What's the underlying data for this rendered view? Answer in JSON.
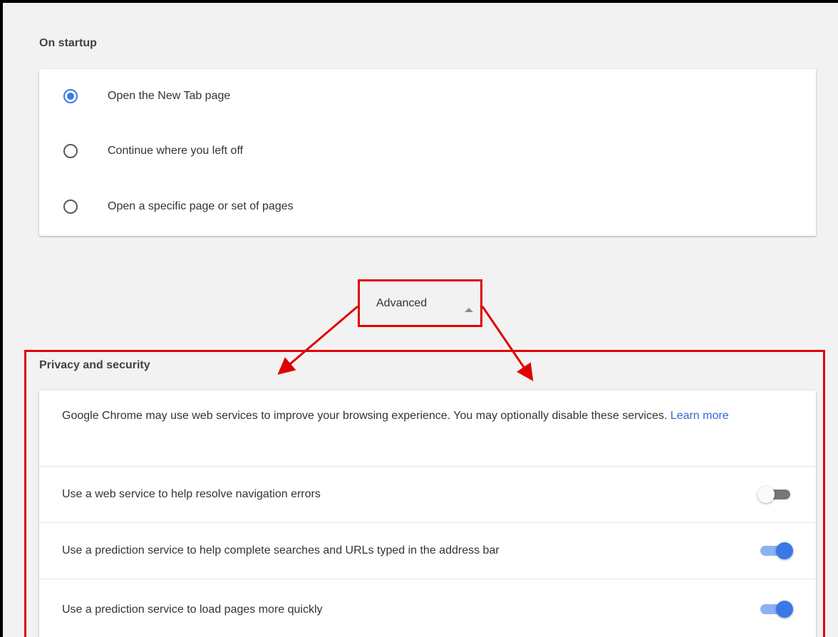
{
  "startup": {
    "title": "On startup",
    "options": [
      {
        "label": "Open the New Tab page",
        "checked": true
      },
      {
        "label": "Continue where you left off",
        "checked": false
      },
      {
        "label": "Open a specific page or set of pages",
        "checked": false
      }
    ]
  },
  "advanced": {
    "label": "Advanced",
    "icon": "caret-up-icon"
  },
  "privacy": {
    "title": "Privacy and security",
    "description": "Google Chrome may use web services to improve your browsing experience. You may optionally disable these services.",
    "learn_more": "Learn more",
    "settings": [
      {
        "label": "Use a web service to help resolve navigation errors",
        "enabled": false
      },
      {
        "label": "Use a prediction service to help complete searches and URLs typed in the address bar",
        "enabled": true
      },
      {
        "label": "Use a prediction service to load pages more quickly",
        "enabled": true
      }
    ]
  },
  "colors": {
    "accent": "#3b78e7",
    "annotation": "#e00000",
    "background": "#f2f2f2"
  }
}
